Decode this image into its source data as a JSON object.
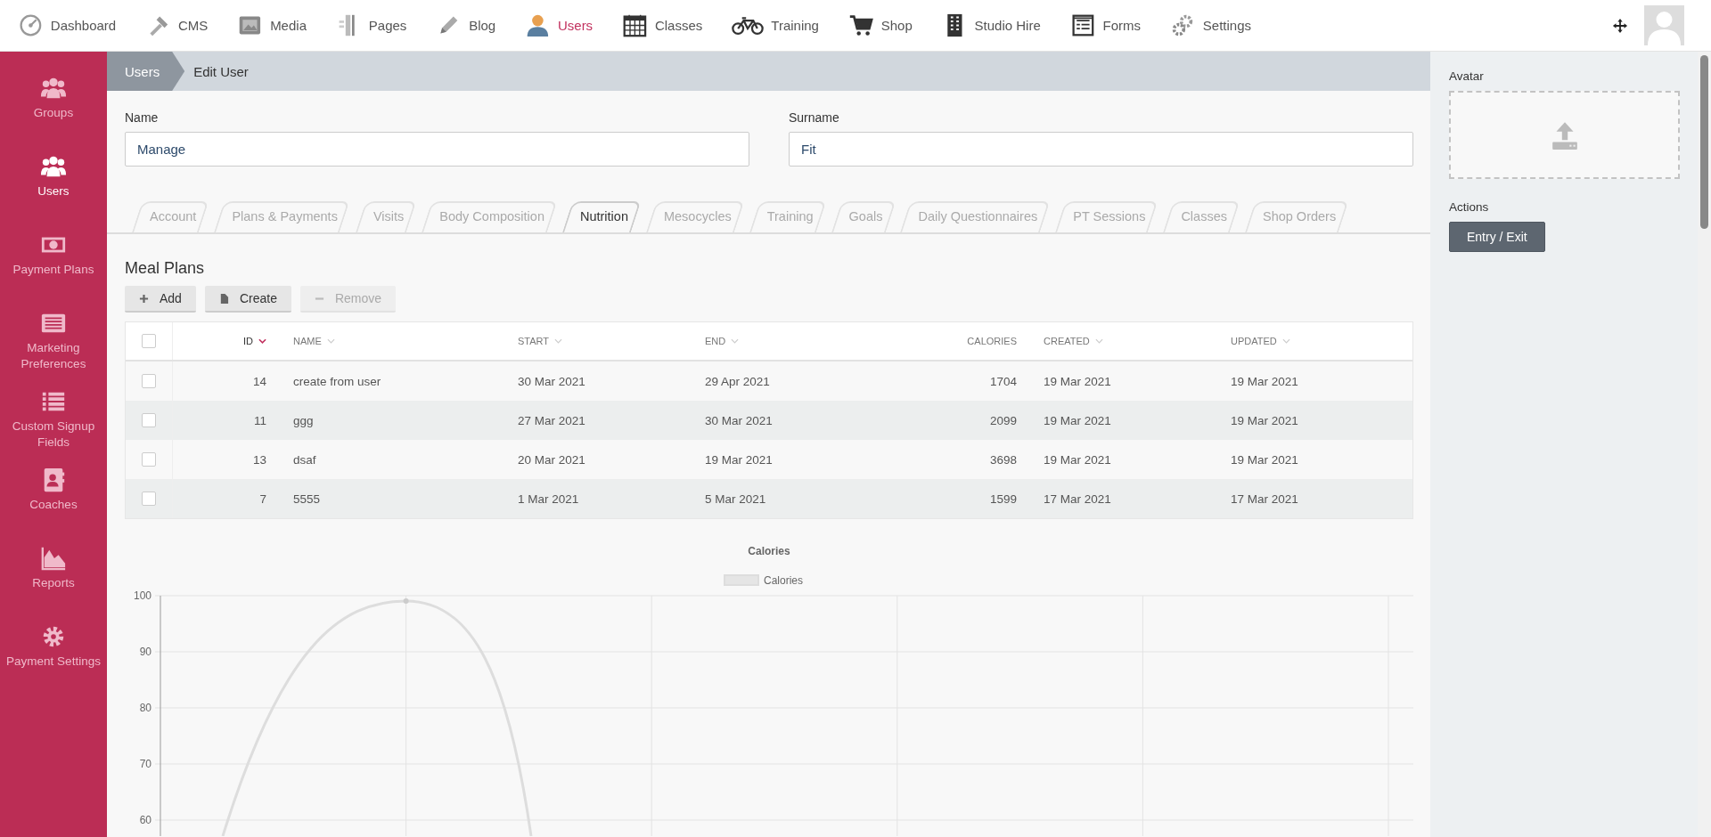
{
  "top_nav": {
    "items": [
      {
        "label": "Dashboard",
        "selected": false
      },
      {
        "label": "CMS",
        "selected": false
      },
      {
        "label": "Media",
        "selected": false
      },
      {
        "label": "Pages",
        "selected": false
      },
      {
        "label": "Blog",
        "selected": false
      },
      {
        "label": "Users",
        "selected": true
      },
      {
        "label": "Classes",
        "selected": false
      },
      {
        "label": "Training",
        "selected": false
      },
      {
        "label": "Shop",
        "selected": false
      },
      {
        "label": "Studio Hire",
        "selected": false
      },
      {
        "label": "Forms",
        "selected": false
      },
      {
        "label": "Settings",
        "selected": false
      }
    ]
  },
  "sidebar": {
    "items": [
      {
        "label": "Groups",
        "selected": false
      },
      {
        "label": "Users",
        "selected": true
      },
      {
        "label": "Payment Plans",
        "selected": false
      },
      {
        "label": "Marketing Preferences",
        "selected": false
      },
      {
        "label": "Custom Signup Fields",
        "selected": false
      },
      {
        "label": "Coaches",
        "selected": false
      },
      {
        "label": "Reports",
        "selected": false
      },
      {
        "label": "Payment Settings",
        "selected": false
      }
    ]
  },
  "breadcrumb": [
    "Users",
    "Edit User"
  ],
  "fields": [
    {
      "label": "Name",
      "value": "Manage"
    },
    {
      "label": "Surname",
      "value": "Fit"
    }
  ],
  "tabs": [
    {
      "label": "Account",
      "selected": false
    },
    {
      "label": "Plans & Payments",
      "selected": false
    },
    {
      "label": "Visits",
      "selected": false
    },
    {
      "label": "Body Composition",
      "selected": false
    },
    {
      "label": "Nutrition",
      "selected": true
    },
    {
      "label": "Mesocycles",
      "selected": false
    },
    {
      "label": "Training",
      "selected": false
    },
    {
      "label": "Goals",
      "selected": false
    },
    {
      "label": "Daily Questionnaires",
      "selected": false
    },
    {
      "label": "PT Sessions",
      "selected": false
    },
    {
      "label": "Classes",
      "selected": false
    },
    {
      "label": "Shop Orders",
      "selected": false
    }
  ],
  "meal_plans": {
    "title": "Meal Plans",
    "buttons": [
      {
        "label": "Add",
        "disabled": false
      },
      {
        "label": "Create",
        "disabled": false
      },
      {
        "label": "Remove",
        "disabled": true
      }
    ],
    "table": {
      "select_all_checked": false,
      "columns": [
        {
          "label": "ID",
          "sortable": true,
          "sorted": true
        },
        {
          "label": "NAME",
          "sortable": true,
          "sorted": false
        },
        {
          "label": "START",
          "sortable": true,
          "sorted": false
        },
        {
          "label": "END",
          "sortable": true,
          "sorted": false
        },
        {
          "label": "CALORIES",
          "sortable": false,
          "sorted": false
        },
        {
          "label": "CREATED",
          "sortable": true,
          "sorted": false
        },
        {
          "label": "UPDATED",
          "sortable": true,
          "sorted": false
        }
      ],
      "rows": [
        {
          "checked": false,
          "cells": [
            "14",
            "create from user",
            "30 Mar 2021",
            "29 Apr 2021",
            "1704",
            "19 Mar 2021",
            "19 Mar 2021"
          ]
        },
        {
          "checked": false,
          "cells": [
            "11",
            "ggg",
            "27 Mar 2021",
            "30 Mar 2021",
            "2099",
            "19 Mar 2021",
            "19 Mar 2021"
          ]
        },
        {
          "checked": false,
          "cells": [
            "13",
            "dsaf",
            "20 Mar 2021",
            "19 Mar 2021",
            "3698",
            "19 Mar 2021",
            "19 Mar 2021"
          ]
        },
        {
          "checked": false,
          "cells": [
            "7",
            "5555",
            "1 Mar 2021",
            "5 Mar 2021",
            "1599",
            "17 Mar 2021",
            "17 Mar 2021"
          ]
        }
      ]
    },
    "calories_chart": {
      "title": "Calories",
      "legend": "Calories",
      "y_labels": [
        "100",
        "90",
        "80",
        "70",
        "60"
      ]
    }
  },
  "side_panel": {
    "avatar_label": "Avatar",
    "actions_label": "Actions",
    "action_button": "Entry / Exit"
  }
}
